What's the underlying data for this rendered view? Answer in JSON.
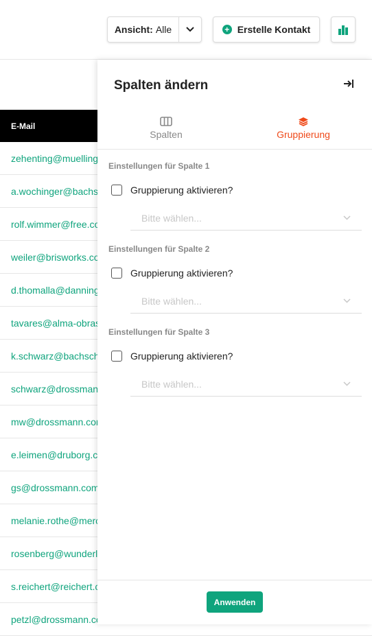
{
  "toolbar": {
    "view_prefix": "Ansicht:",
    "view_value": "Alle",
    "create_label": "Erstelle Kontakt",
    "accent_color": "#0fa47d"
  },
  "table": {
    "column_header": "E-Mail",
    "rows": [
      "zehenting@muelling",
      "a.wochinger@bachs",
      "rolf.wimmer@free.co",
      "weiler@brisworks.co",
      "d.thomalla@danning",
      "tavares@alma-obras",
      "k.schwarz@bachsch",
      "schwarz@drossman",
      "mw@drossmann.cor",
      "e.leimen@druborg.c",
      "gs@drossmann.com",
      "melanie.rothe@merc",
      "rosenberg@wunderli",
      "s.reichert@reichert.c",
      "petzl@drossmann.co"
    ]
  },
  "panel": {
    "title": "Spalten ändern",
    "tabs": [
      {
        "label": "Spalten",
        "icon": "columns-icon",
        "active": false
      },
      {
        "label": "Gruppierung",
        "icon": "layers-icon",
        "active": true
      }
    ],
    "active_tab_color": "#ef4a1a",
    "sections": [
      {
        "title": "Einstellungen für Spalte 1",
        "checkbox_label": "Gruppierung aktivieren?",
        "checked": false,
        "select_placeholder": "Bitte wählen..."
      },
      {
        "title": "Einstellungen für Spalte 2",
        "checkbox_label": "Gruppierung aktivieren?",
        "checked": false,
        "select_placeholder": "Bitte wählen..."
      },
      {
        "title": "Einstellungen für Spalte 3",
        "checkbox_label": "Gruppierung aktivieren?",
        "checked": false,
        "select_placeholder": "Bitte wählen..."
      }
    ],
    "apply_label": "Anwenden"
  }
}
